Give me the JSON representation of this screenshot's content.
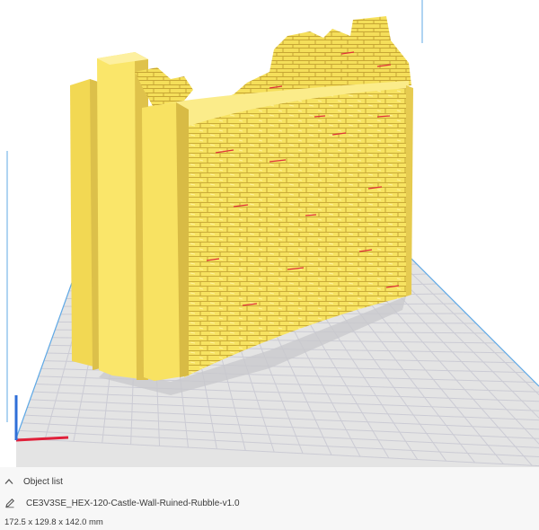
{
  "object_list": {
    "header_label": "Object list",
    "object_name": "CE3V3SE_HEX-120-Castle-Wall-Ruined-Rubble-v1.0",
    "dimensions": "172.5 x 129.8 x 142.0 mm"
  },
  "icons": {
    "collapse": "chevron-up-icon",
    "rename": "pencil-icon"
  },
  "colors": {
    "model": "#f9e667",
    "model_shadow": "#dcc04a",
    "build_plate": "#e4e4e4",
    "grid_line": "#c9c9d3",
    "plate_border": "#5fa9e6",
    "axis_x": "#e0203a",
    "axis_y": "#2f6fd8",
    "overhang": "#e0303a"
  }
}
